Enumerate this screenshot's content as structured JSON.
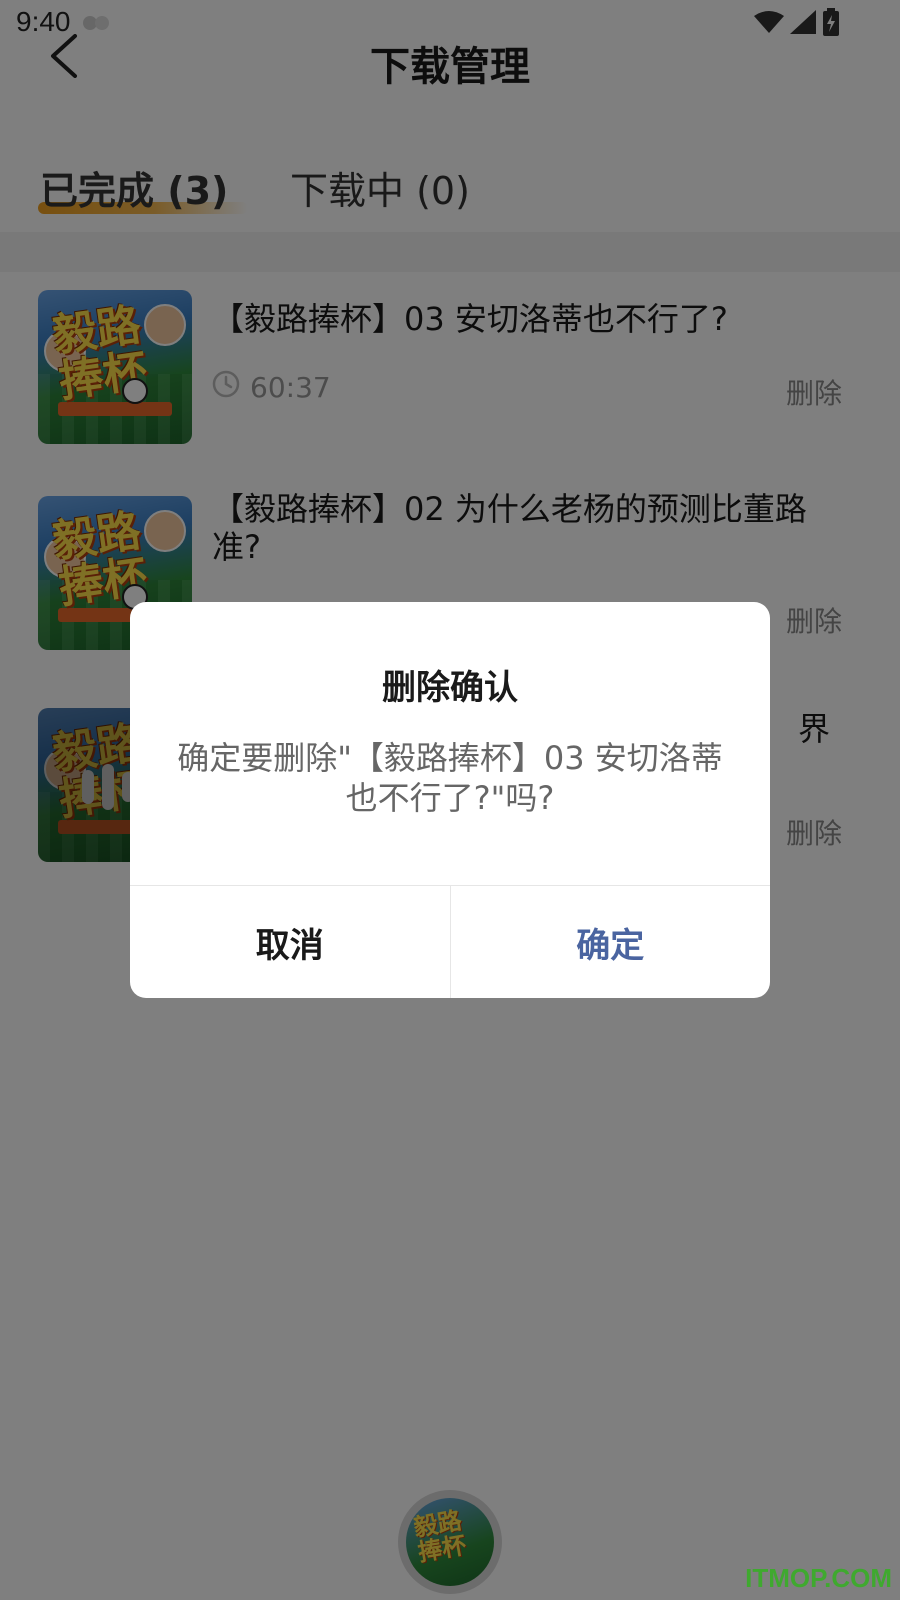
{
  "status_bar": {
    "time": "9:40"
  },
  "header": {
    "title": "下载管理",
    "back_icon": "chevron-left-icon"
  },
  "tabs": [
    {
      "label": "已完成 (3)",
      "active": true
    },
    {
      "label": "下载中 (0)",
      "active": false
    }
  ],
  "downloads": [
    {
      "title": "【毅路捧杯】03 安切洛蒂也不行了?",
      "duration": "60:37",
      "delete_label": "删除",
      "thumb_text": "毅路\n捧杯"
    },
    {
      "title": "【毅路捧杯】02 为什么老杨的预测比董路准?",
      "delete_label": "删除",
      "thumb_text": "毅路\n捧杯"
    },
    {
      "title_visible_fragment": "界",
      "delete_label": "删除",
      "thumb_text": "毅路\n捧杯",
      "playing": true
    }
  ],
  "dialog": {
    "title": "删除确认",
    "message": "确定要删除\"【毅路捧杯】03 安切洛蒂也不行了?\"吗?",
    "cancel_label": "取消",
    "confirm_label": "确定"
  },
  "mini_player": {
    "disc_text": "毅路\n捧杯"
  },
  "watermark": "ITMOP.COM",
  "colors": {
    "accent_tab": "#f0a020",
    "confirm": "#4a64a0",
    "watermark": "#3fa92f"
  }
}
